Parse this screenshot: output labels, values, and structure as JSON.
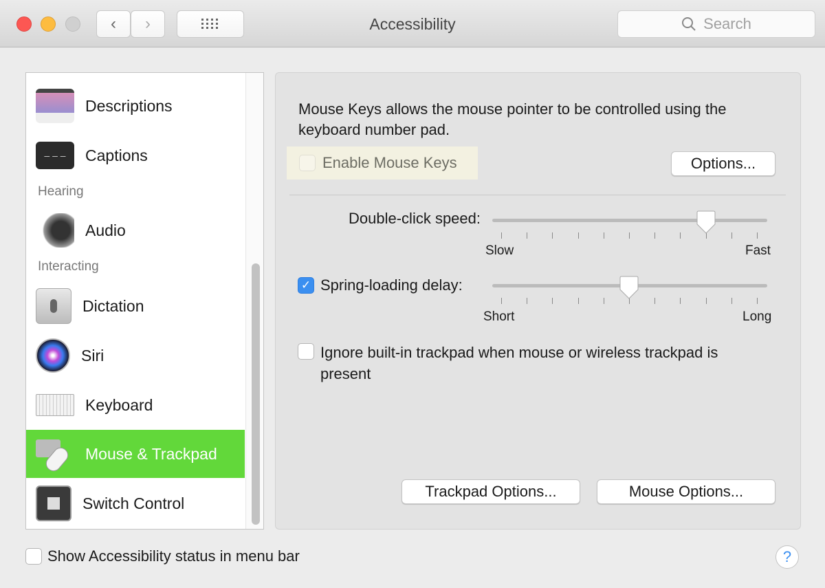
{
  "window": {
    "title": "Accessibility",
    "search_placeholder": "Search",
    "colors": {
      "close": "#fc5753",
      "minimize": "#fdbc40",
      "zoom": "#d0d0d0",
      "selection": "#62d83a",
      "checkbox": "#3b8ff0"
    }
  },
  "sidebar": {
    "items": [
      {
        "label": "Descriptions",
        "icon": "descriptions-icon"
      },
      {
        "label": "Captions",
        "icon": "captions-icon"
      },
      {
        "label": "Audio",
        "icon": "speaker-icon"
      },
      {
        "label": "Dictation",
        "icon": "microphone-icon"
      },
      {
        "label": "Siri",
        "icon": "siri-icon"
      },
      {
        "label": "Keyboard",
        "icon": "keyboard-icon"
      },
      {
        "label": "Mouse & Trackpad",
        "icon": "mouse-trackpad-icon",
        "selected": true
      },
      {
        "label": "Switch Control",
        "icon": "switch-control-icon"
      }
    ],
    "headers": [
      "Hearing",
      "Interacting"
    ]
  },
  "main": {
    "description": "Mouse Keys allows the mouse pointer to be controlled using the keyboard number pad.",
    "enable_mouse_keys": {
      "label": "Enable Mouse Keys",
      "checked": false
    },
    "options_button": "Options...",
    "double_click": {
      "label": "Double-click speed:",
      "min_label": "Slow",
      "max_label": "Fast",
      "value": 0.8,
      "ticks": 11
    },
    "spring_loading": {
      "label": "Spring-loading delay:",
      "checked": true,
      "min_label": "Short",
      "max_label": "Long",
      "value": 0.5,
      "ticks": 11
    },
    "ignore_trackpad": {
      "label": "Ignore built-in trackpad when mouse or wireless trackpad is present",
      "checked": false
    },
    "trackpad_options_button": "Trackpad Options...",
    "mouse_options_button": "Mouse Options..."
  },
  "footer": {
    "status_checkbox": {
      "label": "Show Accessibility status in menu bar",
      "checked": false
    },
    "help": "?"
  }
}
